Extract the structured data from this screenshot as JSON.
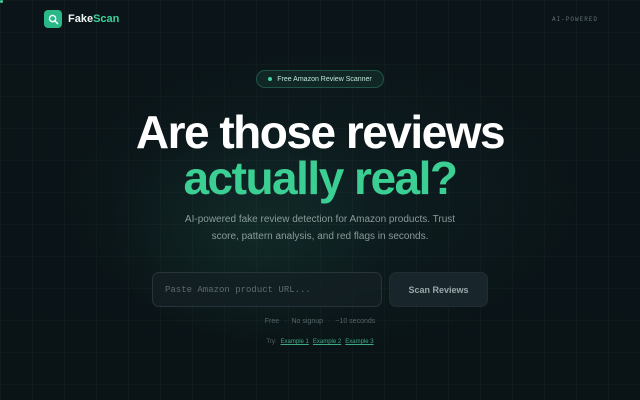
{
  "header": {
    "brand_prefix": "Fake",
    "brand_suffix": "Scan",
    "right_tag": "AI-POWERED"
  },
  "hero": {
    "badge": "Free Amazon Review Scanner",
    "title_line1": "Are those reviews",
    "title_line2": "actually real?",
    "subtitle": "AI-powered fake review detection for Amazon products. Trust score, pattern analysis, and red flags in seconds."
  },
  "search": {
    "placeholder": "Paste Amazon product URL...",
    "value": "",
    "button_label": "Scan Reviews"
  },
  "meta": {
    "items": [
      "Free",
      "No signup",
      "~10 seconds"
    ],
    "separator": "·"
  },
  "examples": {
    "label": "Try:",
    "links": [
      "Example 1",
      "Example 2",
      "Example 3"
    ]
  },
  "colors": {
    "accent": "#3ccf94",
    "background": "#0a1418",
    "logo": "#2bb889"
  },
  "icons": {
    "logo": "magnifier-icon",
    "badge": "status-dot-icon"
  }
}
